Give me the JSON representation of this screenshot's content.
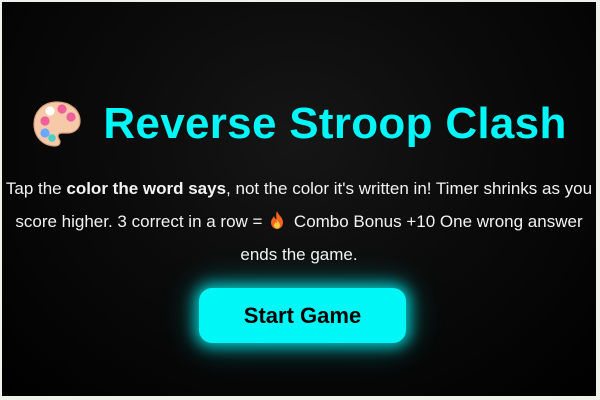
{
  "game": {
    "title": "Reverse Stroop Clash",
    "title_icon": "palette-icon",
    "accent_color": "#00f7f7",
    "background_color": "#000000",
    "instructions": {
      "part1": "Tap the ",
      "bold": "color the word says",
      "part2": ", not the color it's written in! Timer shrinks as you score higher. 3 correct in a row = ",
      "combo_icon": "fire-icon",
      "part3": " Combo Bonus +10 One wrong answer ends the game."
    },
    "start_button_label": "Start Game"
  }
}
